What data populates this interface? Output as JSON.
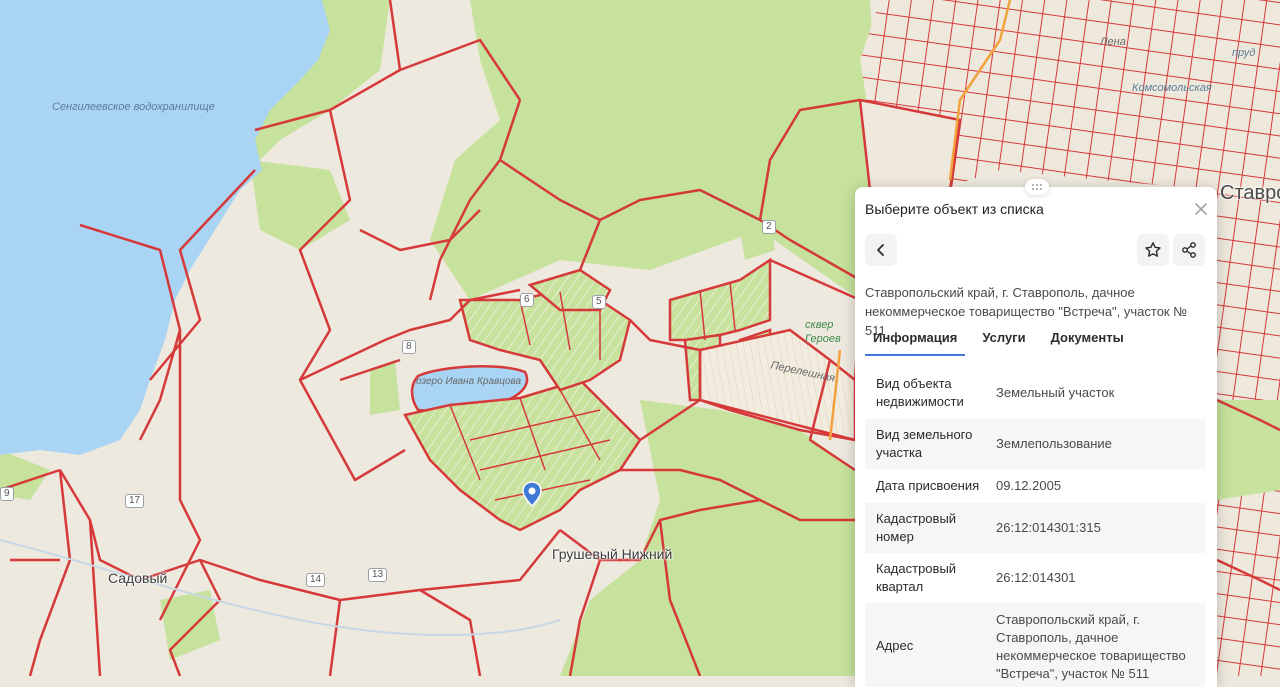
{
  "map": {
    "labels": {
      "reservoir": "Сенгилеевское водохранилище",
      "lake": "озеро Ивана Кравцова",
      "village_nizhny": "Грушевый Нижний",
      "village_sadovy": "Садовый",
      "city": "Ставрополь",
      "square": "сквер Героев России",
      "street_komsomolskaya": "Комсомольская",
      "street_pereleshnaya": "Перелешная",
      "pond": "пруд",
      "street_top": "Лена"
    },
    "road_numbers": [
      "17",
      "14",
      "13",
      "8",
      "6",
      "5",
      "2",
      "9"
    ],
    "colors": {
      "water": "#a9d4f3",
      "land": "#eee9de",
      "forest": "#c6e29c",
      "parcel_border": "#d6393a",
      "road_major": "#f2a23c",
      "marker": "#3f7ad6"
    },
    "marker_icon": "location-pin-icon"
  },
  "panel": {
    "title": "Выберите объект из списка",
    "close_icon": "close-icon",
    "back_icon": "chevron-left-icon",
    "favorite_icon": "star-icon",
    "share_icon": "share-icon",
    "object_address": "Ставропольский край, г. Ставрополь, дачное некоммерческое товарищество \"Встреча\", участок № 511",
    "tabs": [
      {
        "label": "Информация",
        "active": true
      },
      {
        "label": "Услуги",
        "active": false
      },
      {
        "label": "Документы",
        "active": false
      }
    ],
    "info_rows": [
      {
        "key": "Вид объекта недвижимости",
        "value": "Земельный участок"
      },
      {
        "key": "Вид земельного участка",
        "value": "Землепользование"
      },
      {
        "key": "Дата присвоения",
        "value": "09.12.2005"
      },
      {
        "key": "Кадастровый номер",
        "value": "26:12:014301:315"
      },
      {
        "key": "Кадастровый квартал",
        "value": "26:12:014301"
      },
      {
        "key": "Адрес",
        "value": "Ставропольский край, г. Ставрополь, дачное некоммерческое товарищество \"Встреча\", участок № 511"
      }
    ]
  }
}
